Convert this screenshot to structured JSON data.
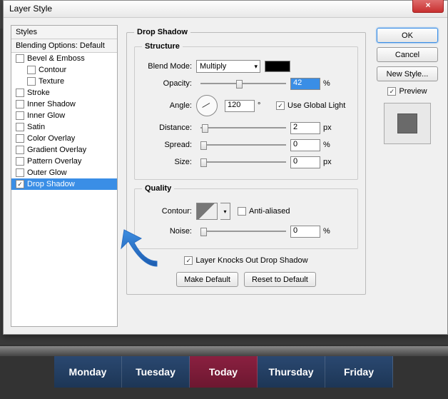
{
  "dialog": {
    "title": "Layer Style",
    "close_glyph": "×"
  },
  "styles": {
    "header": "Styles",
    "blending": "Blending Options: Default",
    "items": [
      {
        "label": "Bevel & Emboss",
        "checked": false,
        "indent": false
      },
      {
        "label": "Contour",
        "checked": false,
        "indent": true
      },
      {
        "label": "Texture",
        "checked": false,
        "indent": true
      },
      {
        "label": "Stroke",
        "checked": false,
        "indent": false
      },
      {
        "label": "Inner Shadow",
        "checked": false,
        "indent": false
      },
      {
        "label": "Inner Glow",
        "checked": false,
        "indent": false
      },
      {
        "label": "Satin",
        "checked": false,
        "indent": false
      },
      {
        "label": "Color Overlay",
        "checked": false,
        "indent": false
      },
      {
        "label": "Gradient Overlay",
        "checked": false,
        "indent": false
      },
      {
        "label": "Pattern Overlay",
        "checked": false,
        "indent": false
      },
      {
        "label": "Outer Glow",
        "checked": false,
        "indent": false
      },
      {
        "label": "Drop Shadow",
        "checked": true,
        "indent": false,
        "selected": true
      }
    ]
  },
  "dropshadow": {
    "group_title": "Drop Shadow",
    "structure_title": "Structure",
    "blend_mode_label": "Blend Mode:",
    "blend_mode_value": "Multiply",
    "opacity_label": "Opacity:",
    "opacity_value": "42",
    "opacity_unit": "%",
    "angle_label": "Angle:",
    "angle_value": "120",
    "angle_unit": "°",
    "global_light_label": "Use Global Light",
    "global_light_checked": true,
    "distance_label": "Distance:",
    "distance_value": "2",
    "distance_unit": "px",
    "spread_label": "Spread:",
    "spread_value": "0",
    "spread_unit": "%",
    "size_label": "Size:",
    "size_value": "0",
    "size_unit": "px",
    "quality_title": "Quality",
    "contour_label": "Contour:",
    "antialiased_label": "Anti-aliased",
    "antialiased_checked": false,
    "noise_label": "Noise:",
    "noise_value": "0",
    "noise_unit": "%",
    "knockout_label": "Layer Knocks Out Drop Shadow",
    "knockout_checked": true,
    "make_default": "Make Default",
    "reset_default": "Reset to Default"
  },
  "buttons": {
    "ok": "OK",
    "cancel": "Cancel",
    "new_style": "New Style...",
    "preview_label": "Preview",
    "preview_checked": true
  },
  "tabs": {
    "items": [
      {
        "label": "Monday",
        "active": false
      },
      {
        "label": "Tuesday",
        "active": false
      },
      {
        "label": "Today",
        "active": true
      },
      {
        "label": "Thursday",
        "active": false
      },
      {
        "label": "Friday",
        "active": false
      }
    ]
  },
  "bg_hint": "Tuesday"
}
